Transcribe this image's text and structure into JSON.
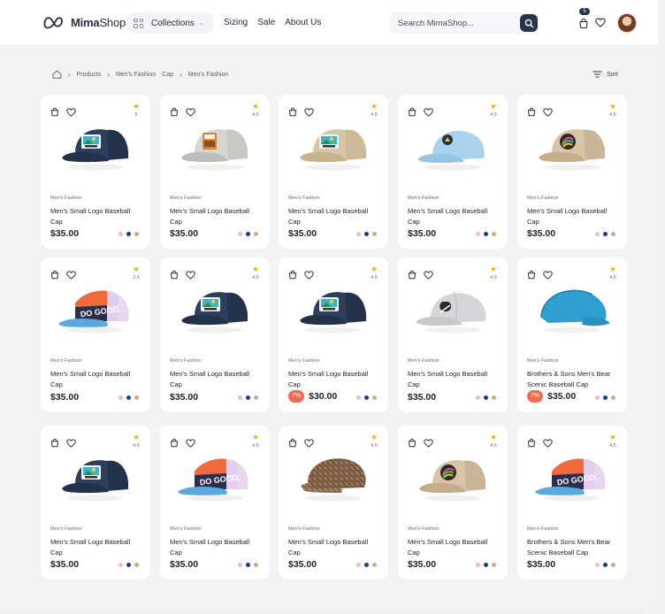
{
  "header": {
    "brand_bold": "Mima",
    "brand_light": "Shop",
    "collections_label": "Collections",
    "nav": [
      "Sizing",
      "Sale",
      "About Us"
    ],
    "search_placeholder": "Search MimaShop...",
    "cart_count": "5"
  },
  "breadcrumb": {
    "items": [
      "Products",
      "Men's Fashion",
      "Cap",
      "Men's Fashion"
    ]
  },
  "sort_label": "Sort",
  "colors": {
    "accent_dark": "#27344b",
    "star": "#f4b400",
    "discount": "#f36a53",
    "swatch_pink": "#f2b8c6",
    "swatch_navy": "#1e3a8a",
    "swatch_tan": "#c9ad82"
  },
  "products": [
    {
      "icon": "navy-trucker-cap",
      "rating": "5",
      "category": "Men's Fashion",
      "name": "Men's Small Logo Baseball Cap",
      "price": "$35.00",
      "discount": ""
    },
    {
      "icon": "grey-patch-trucker-cap",
      "rating": "4.5",
      "category": "Men's Fashion",
      "name": "Men's Small Logo Baseball Cap",
      "price": "$35.00",
      "discount": ""
    },
    {
      "icon": "khaki-trucker-cap",
      "rating": "4.5",
      "category": "Men's Fashion",
      "name": "Men's Small Logo Baseball Cap",
      "price": "$35.00",
      "discount": ""
    },
    {
      "icon": "light-blue-cap",
      "rating": "4.5",
      "category": "Men's Fashion",
      "name": "Men's Small Logo Baseball Cap",
      "price": "$35.00",
      "discount": ""
    },
    {
      "icon": "tan-trucker-cap",
      "rating": "4.5",
      "category": "Men's Fashion",
      "name": "Men's Small Logo Baseball Cap",
      "price": "$35.00",
      "discount": ""
    },
    {
      "icon": "do-good-five-panel-cap",
      "rating": "3.5",
      "category": "Men's Fashion",
      "name": "Men's Small Logo Baseball Cap",
      "price": "$35.00",
      "discount": ""
    },
    {
      "icon": "navy-trucker-cap",
      "rating": "4.5",
      "category": "Men's Fashion",
      "name": "Men's Small Logo Baseball Cap",
      "price": "$35.00",
      "discount": ""
    },
    {
      "icon": "navy-trucker-cap",
      "rating": "4.5",
      "category": "Men's Fashion",
      "name": "Men's Small Logo Baseball Cap",
      "price": "$30.00",
      "discount": "7%"
    },
    {
      "icon": "grey-baseball-cap",
      "rating": "4.5",
      "category": "Men's Fashion",
      "name": "Men's Small Logo Baseball Cap",
      "price": "$35.00",
      "discount": ""
    },
    {
      "icon": "blue-suede-cap",
      "rating": "4.5",
      "category": "Men's Fashion",
      "name": "Brothers & Sons Men's Bear Scenic Baseball Cap",
      "price": "$35.00",
      "discount": "7%"
    },
    {
      "icon": "navy-trucker-cap",
      "rating": "4.5",
      "category": "Men's Fashion",
      "name": "Men's Small Logo Baseball Cap",
      "price": "$35.00",
      "discount": ""
    },
    {
      "icon": "do-good-five-panel-cap",
      "rating": "4.5",
      "category": "Men's Fashion",
      "name": "Men's Small Logo Baseball Cap",
      "price": "$35.00",
      "discount": ""
    },
    {
      "icon": "plaid-ivy-cap",
      "rating": "4.5",
      "category": "Men's Fashion",
      "name": "Men's Small Logo Baseball Cap",
      "price": "$35.00",
      "discount": ""
    },
    {
      "icon": "tan-trucker-cap",
      "rating": "4.5",
      "category": "Men's Fashion",
      "name": "Men's Small Logo Baseball Cap",
      "price": "$35.00",
      "discount": ""
    },
    {
      "icon": "do-good-five-panel-cap",
      "rating": "4.5",
      "category": "Men's Fashion",
      "name": "Brothers & Sons Men's Bear Scenic Baseball Cap",
      "price": "$35.00",
      "discount": ""
    }
  ]
}
